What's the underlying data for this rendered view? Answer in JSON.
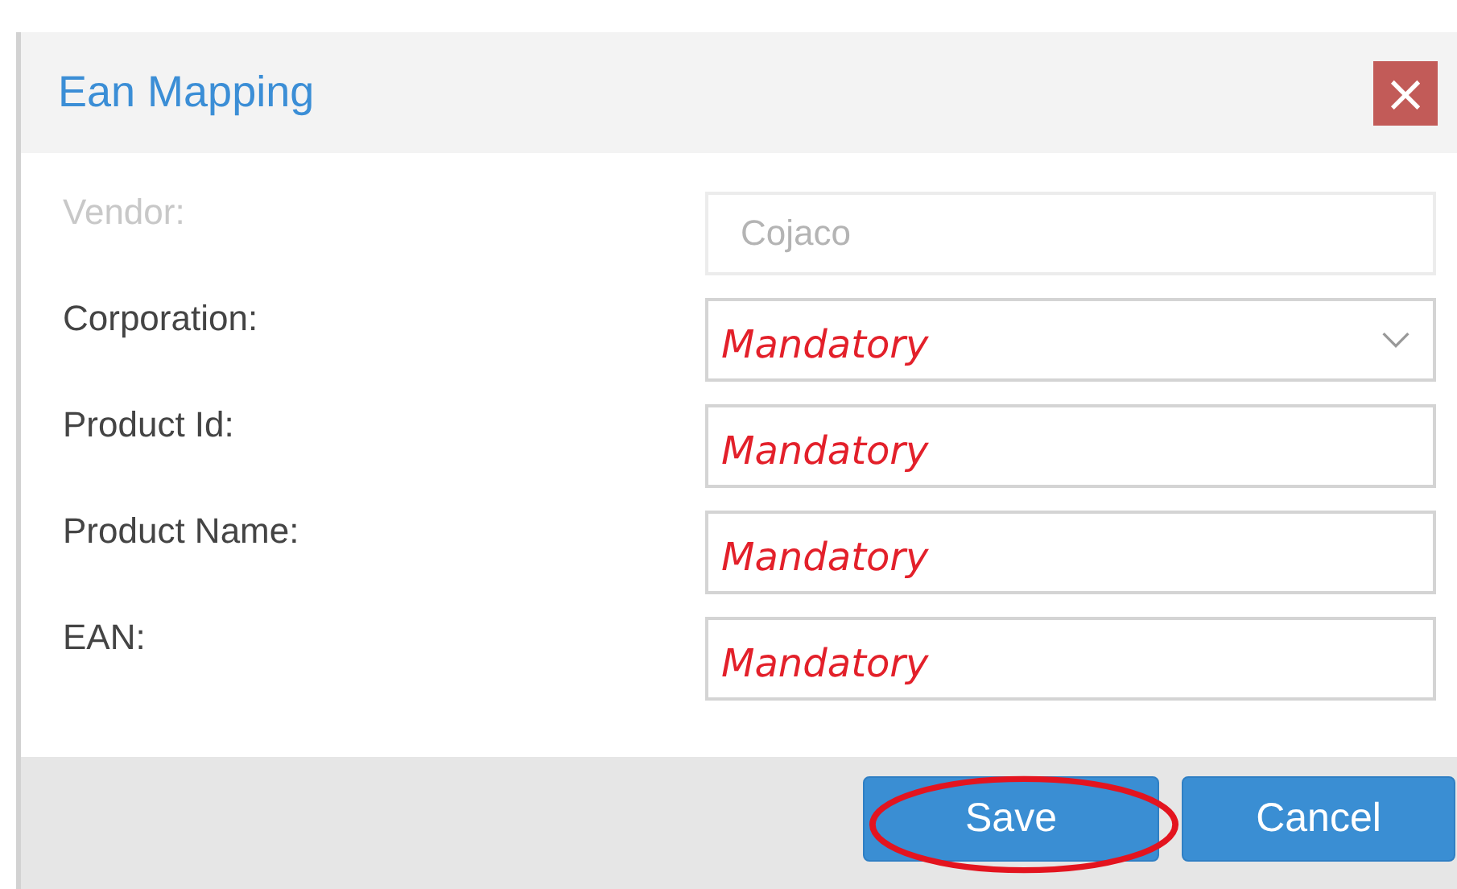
{
  "dialog": {
    "title": "Ean Mapping",
    "close_label": "×"
  },
  "fields": [
    {
      "kind": "text",
      "label": "Vendor:",
      "value": "Cojaco",
      "disabled": true
    },
    {
      "kind": "select",
      "label": "Corporation:",
      "placeholder": "Mandatory",
      "disabled": false
    },
    {
      "kind": "text",
      "label": "Product Id:",
      "placeholder": "Mandatory",
      "disabled": false
    },
    {
      "kind": "text",
      "label": "Product Name:",
      "placeholder": "Mandatory",
      "disabled": false
    },
    {
      "kind": "text",
      "label": "EAN:",
      "placeholder": "Mandatory",
      "disabled": false
    }
  ],
  "buttons": [
    {
      "label": "Save",
      "circled": true
    },
    {
      "label": "Cancel",
      "circled": false
    }
  ]
}
